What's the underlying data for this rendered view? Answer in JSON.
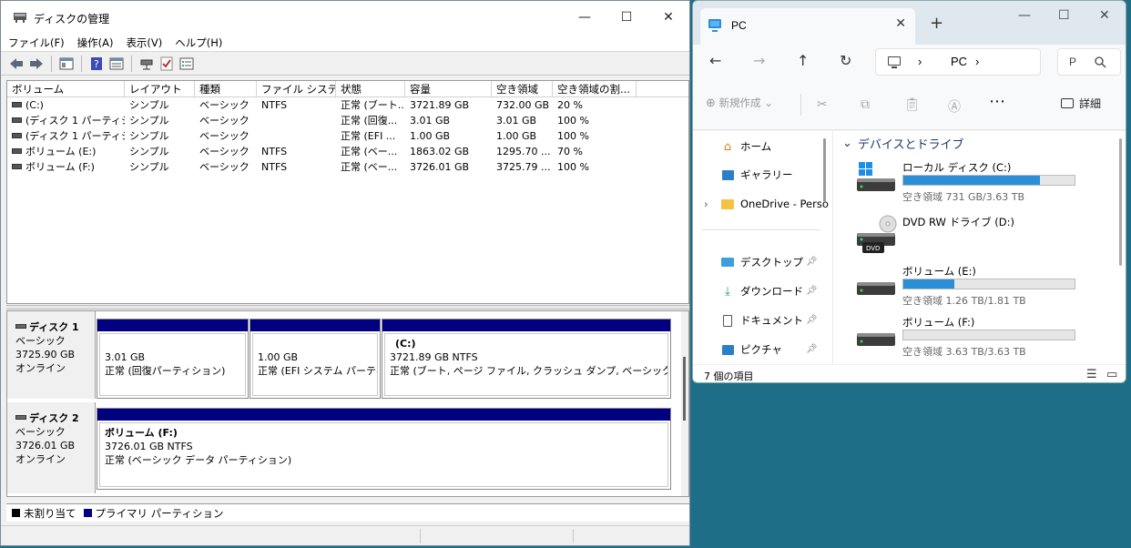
{
  "disk_mgmt": {
    "title": "ディスクの管理",
    "menu": [
      "ファイル(F)",
      "操作(A)",
      "表示(V)",
      "ヘルプ(H)"
    ],
    "columns": [
      "ボリューム",
      "レイアウト",
      "種類",
      "ファイル システム",
      "状態",
      "容量",
      "空き領域",
      "空き領域の割..."
    ],
    "volumes": [
      {
        "name": "(C:)",
        "layout": "シンプル",
        "type": "ベーシック",
        "fs": "NTFS",
        "status": "正常 (ブート...",
        "capacity": "3721.89 GB",
        "free": "732.00 GB",
        "pct": "20 %"
      },
      {
        "name": "(ディスク 1 パーティシ...",
        "layout": "シンプル",
        "type": "ベーシック",
        "fs": "",
        "status": "正常 (回復...",
        "capacity": "3.01 GB",
        "free": "3.01 GB",
        "pct": "100 %"
      },
      {
        "name": "(ディスク 1 パーティシ...",
        "layout": "シンプル",
        "type": "ベーシック",
        "fs": "",
        "status": "正常 (EFI ...",
        "capacity": "1.00 GB",
        "free": "1.00 GB",
        "pct": "100 %"
      },
      {
        "name": "ボリューム (E:)",
        "layout": "シンプル",
        "type": "ベーシック",
        "fs": "NTFS",
        "status": "正常 (ベー...",
        "capacity": "1863.02 GB",
        "free": "1295.70 ...",
        "pct": "70 %"
      },
      {
        "name": "ボリューム (F:)",
        "layout": "シンプル",
        "type": "ベーシック",
        "fs": "NTFS",
        "status": "正常 (ベー...",
        "capacity": "3726.01 GB",
        "free": "3725.79 ...",
        "pct": "100 %"
      }
    ],
    "disk1": {
      "name": "ディスク 1",
      "kind": "ベーシック",
      "size": "3725.90 GB",
      "state": "オンライン",
      "p1": {
        "size": "3.01 GB",
        "status": "正常 (回復パーティション)"
      },
      "p2": {
        "size": "1.00 GB",
        "status": "正常 (EFI システム パーティシ"
      },
      "p3": {
        "label": "(C:)",
        "size": "3721.89 GB NTFS",
        "status": "正常 (ブート, ページ ファイル, クラッシュ ダンプ, ベーシック データ パー"
      }
    },
    "disk2": {
      "name": "ディスク 2",
      "kind": "ベーシック",
      "size": "3726.01 GB",
      "state": "オンライン",
      "p1": {
        "label": "ボリューム  (F:)",
        "size": "3726.01 GB NTFS",
        "status": "正常 (ベーシック データ パーティション)"
      }
    },
    "legend": {
      "unallocated": "未割り当て",
      "primary": "プライマリ パーティション"
    },
    "colors": {
      "primary": "#000080",
      "unallocated": "#000000"
    }
  },
  "explorer": {
    "tab_title": "PC",
    "breadcrumb": "PC",
    "search_placeholder": "P",
    "new_label": "新規作成",
    "details_label": "詳細",
    "sidebar": {
      "home": "ホーム",
      "gallery": "ギャラリー",
      "onedrive": "OneDrive - Perso",
      "desktop": "デスクトップ",
      "downloads": "ダウンロード",
      "documents": "ドキュメント",
      "pictures": "ピクチャ"
    },
    "group": "デバイスとドライブ",
    "drives": [
      {
        "name": "ローカル ディスク (C:)",
        "free": "空き領域 731 GB/3.63 TB",
        "used_fraction": 0.8
      },
      {
        "name": "DVD RW ドライブ (D:)",
        "free": "",
        "used_fraction": null
      },
      {
        "name": "ボリューム (E:)",
        "free": "空き領域 1.26 TB/1.81 TB",
        "used_fraction": 0.3
      },
      {
        "name": "ボリューム (F:)",
        "free": "空き領域 3.63 TB/3.63 TB",
        "used_fraction": 0.0
      }
    ],
    "dvd_badge": "DVD",
    "status": "7 個の項目",
    "accent": "#2b8fd8"
  }
}
